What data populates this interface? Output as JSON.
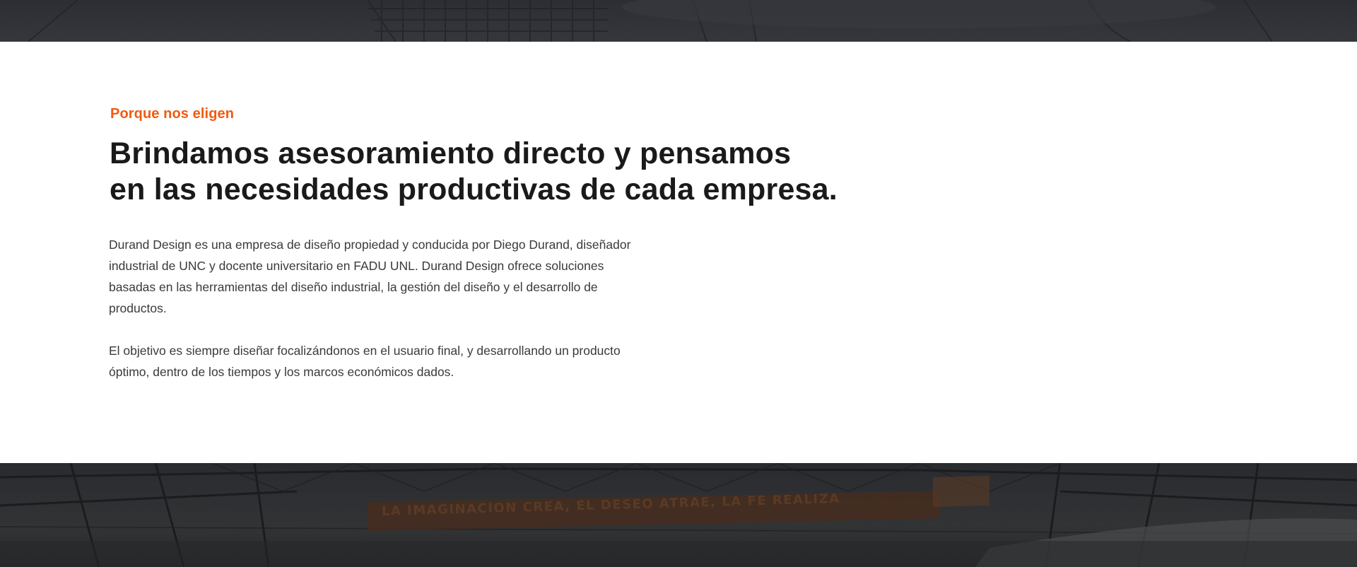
{
  "about": {
    "eyebrow": "Porque nos eligen",
    "headline_line1": "Brindamos asesoramiento directo y pensamos",
    "headline_line2": "en las necesidades productivas de cada empresa.",
    "paragraph1": "Durand Design es una empresa de diseño propiedad y conducida por Diego Durand, diseñador industrial de UNC y docente universitario en FADU UNL. Durand Design ofrece soluciones basadas en las herramientas del diseño industrial, la gestión del diseño y el desarrollo de productos.",
    "paragraph2": "El objetivo es siempre diseñar focalizándonos en el usuario final, y desarrollando un producto óptimo, dentro de los tiempos y los marcos económicos dados."
  },
  "bottom_image": {
    "banner_text": "LA IMAGINACION CREA, EL DESEO ATRAE, LA FE REALIZA"
  },
  "colors": {
    "accent": "#f15a0f",
    "heading": "#1a1a1a",
    "body": "#3a3a3a",
    "dark_band": "#2c2e33"
  }
}
